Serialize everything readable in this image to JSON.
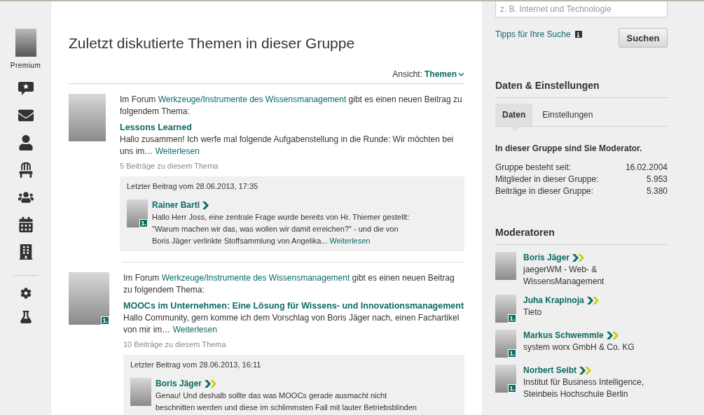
{
  "sidebar": {
    "profile_label": "Premium",
    "items": [
      {
        "kind": "comment-star"
      },
      {
        "kind": "mail"
      },
      {
        "kind": "user"
      },
      {
        "kind": "chair"
      },
      {
        "kind": "group"
      },
      {
        "kind": "calendar"
      },
      {
        "kind": "buildings"
      },
      {
        "kind": "divider"
      },
      {
        "kind": "gear"
      },
      {
        "kind": "flask"
      }
    ]
  },
  "main": {
    "title": "Zuletzt diskutierte Themen in dieser Gruppe",
    "view_label": "Ansicht:",
    "view_value": "Themen",
    "posts": [
      {
        "intro_before": "Im Forum ",
        "forum": "Werkzeuge/Instrumente des Wissensmanagement",
        "intro_after": " gibt es einen neuen Beitrag zu folgendem Thema:",
        "topic": "Lessons Learned",
        "excerpt": "Hallo zusammen! Ich werfe mal folgende Aufgabenstellung in die Runde: Wir möchten bei uns im…",
        "read_more": "Weiterlesen",
        "count": "5 Beiträge zu diesem Thema",
        "last_post": {
          "date": "Letzter Beitrag vom 28.06.2013, 17:35",
          "author": "Rainer Bartl",
          "kind": "single",
          "badge": "1.",
          "text": "Hallo Herr Joss, eine zentrale Frage wurde bereits von Hr. Thiemer gestellt: \"Warum machen wir das, was wollen wir damit erreichen?\" - und die von Boris Jäger verlinkte Stoffsammlung von Angelika...",
          "read_more": "Weiterlesen"
        }
      },
      {
        "intro_before": "Im Forum ",
        "forum": "Werkzeuge/Instrumente des Wissensmanagement",
        "intro_after": " gibt es einen neuen Beitrag zu folgendem Thema:",
        "badge": "1.",
        "topic": "MOOCs im Unternehmen: Eine Lösung für Wissens- und Innovationsmanagement",
        "excerpt": "Hallo Community, gern komme ich dem Vorschlag von Boris Jäger nach, einen Fachartikel von mir im…",
        "read_more": "Weiterlesen",
        "count": "10 Beiträge zu diesem Thema",
        "last_post": {
          "date": "Letzter Beitrag vom 28.06.2013, 16:11",
          "author": "Boris Jäger",
          "kind": "double",
          "text": "Genau! Und deshalb sollte das was MOOCs gerade ausmacht nicht beschnitten werden und diese im schlimmsten Fall mit lauter Betriebsblinden"
        }
      }
    ]
  },
  "right": {
    "search": {
      "placeholder": "z. B. Internet und Technologie",
      "tips": "Tipps für Ihre Suche",
      "button": "Suchen"
    },
    "data_heading": "Daten & Einstellungen",
    "tabs": [
      {
        "label": "Daten",
        "selected": true
      },
      {
        "label": "Einstellungen",
        "selected": false
      }
    ],
    "moderator_note": "In dieser Gruppe sind Sie Moderator.",
    "stats": [
      {
        "label": "Gruppe besteht seit:",
        "value": "16.02.2004"
      },
      {
        "label": "Mitglieder in dieser Gruppe:",
        "value": "5.953"
      },
      {
        "label": "Beiträge in dieser Gruppe:",
        "value": "5.380"
      }
    ],
    "moderators_heading": "Moderatoren",
    "moderators": [
      {
        "name": "Boris Jäger",
        "kind": "double",
        "company": "jaegerWM - Web- & WissensManagement"
      },
      {
        "name": "Juha Krapinoja",
        "kind": "double",
        "badge": "1.",
        "company": "Tieto"
      },
      {
        "name": "Markus Schwemmle",
        "kind": "double",
        "badge": "1.",
        "company": "system worx GmbH & Co. KG"
      },
      {
        "name": "Norbert Seibt",
        "kind": "double",
        "badge": "1.",
        "company": "Institut für Business Intelligence, Steinbeis Hochschule Berlin"
      }
    ]
  }
}
